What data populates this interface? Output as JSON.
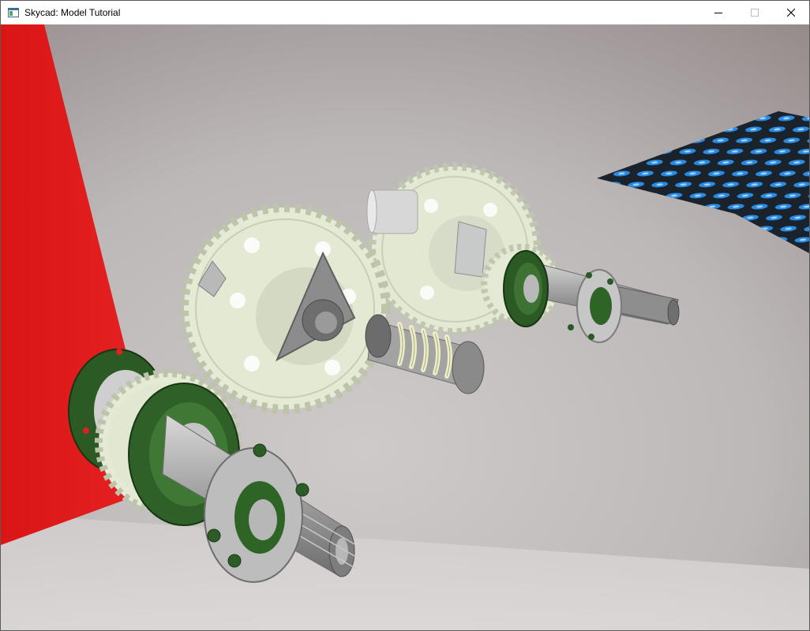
{
  "window": {
    "title": "Skycad: Model Tutorial",
    "icons": {
      "app": "app-window-icon",
      "minimize": "minimize-icon",
      "maximize": "maximize-icon",
      "close": "close-icon"
    }
  },
  "scene": {
    "description_hidden": "",
    "colors": {
      "wall_red": "#e01818",
      "background_light": "#c9c6c6",
      "background_dark": "#9d9494",
      "gear": "#dfe6cf",
      "gear_shade": "#bfc7ae",
      "bearing_green": "#2e5f27",
      "shaft_gray": "#9e9e9e",
      "spring_yellow": "#ecebb8",
      "floor_tile": "#1b2430",
      "floor_accent": "#2b8fe6"
    }
  }
}
